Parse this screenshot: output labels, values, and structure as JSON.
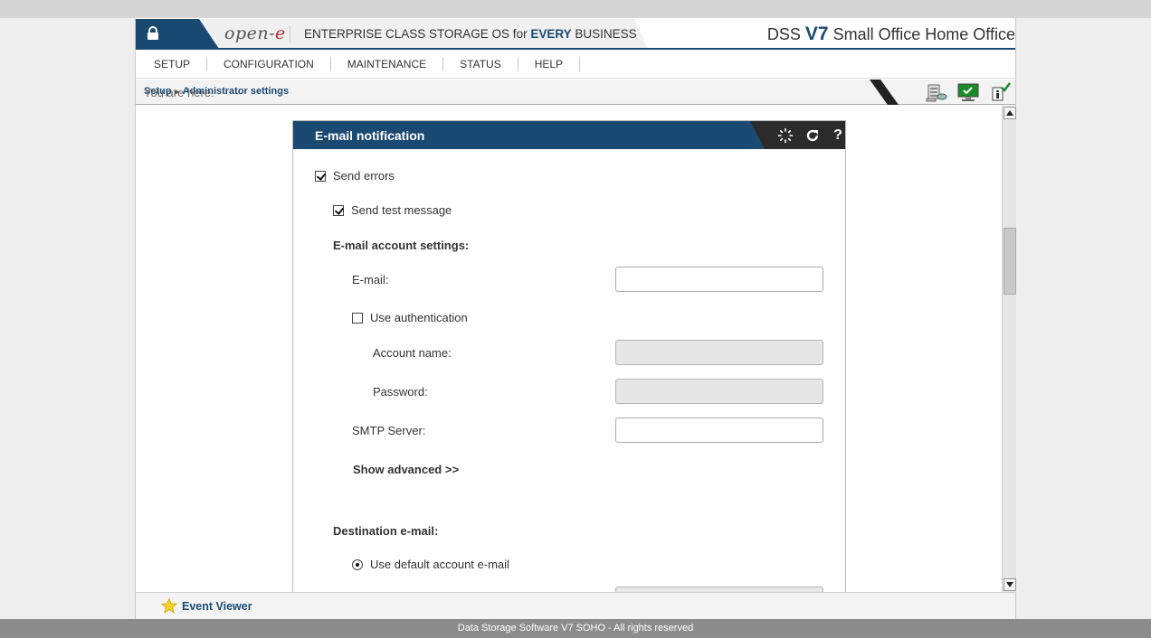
{
  "header": {
    "logo_main": "open-",
    "logo_e": "e",
    "tagline_pre": "ENTERPRISE CLASS STORAGE OS for ",
    "tagline_bold": "EVERY",
    "tagline_post": " BUSINESS",
    "product_prefix": "DSS ",
    "product_version": "V7",
    "product_suffix": " Small Office Home Office"
  },
  "nav": {
    "items": [
      "SETUP",
      "CONFIGURATION",
      "MAINTENANCE",
      "STATUS",
      "HELP"
    ]
  },
  "breadcrumb": {
    "label": "You are here:",
    "items": [
      "Setup",
      "Administrator settings"
    ]
  },
  "panel": {
    "title": "E-mail notification",
    "send_errors": {
      "label": "Send errors",
      "checked": true
    },
    "send_test": {
      "label": "Send test message",
      "checked": true
    },
    "account_section": "E-mail account settings:",
    "email_label": "E-mail:",
    "email_value": "",
    "use_auth": {
      "label": "Use authentication",
      "checked": false
    },
    "account_name_label": "Account name:",
    "password_label": "Password:",
    "smtp_label": "SMTP Server:",
    "smtp_value": "",
    "show_advanced": "Show advanced >>",
    "destination_section": "Destination e-mail:",
    "use_default": {
      "label": "Use default account e-mail",
      "checked": true
    }
  },
  "bottom": {
    "event_viewer": "Event Viewer",
    "footer": "Data Storage Software V7 SOHO - All rights reserved"
  },
  "colors": {
    "brand": "#1a4a72",
    "accent_red": "#c0262d",
    "dark": "#2b2b2b"
  },
  "icons": [
    "lock-icon",
    "refresh-spinner-icon",
    "reload-icon",
    "help-icon",
    "storage-icon",
    "monitor-icon",
    "info-check-icon",
    "star-icon"
  ]
}
